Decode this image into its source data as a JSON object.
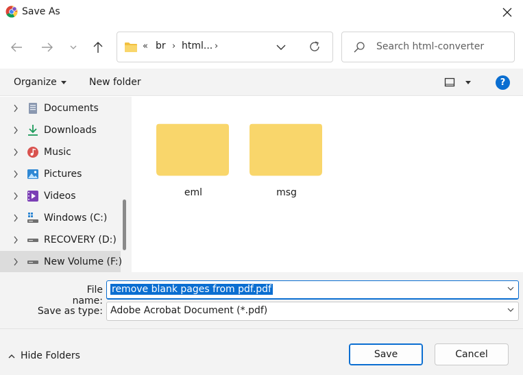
{
  "window": {
    "title": "Save As",
    "app_icon": "chrome-icon",
    "close_icon": "close-icon"
  },
  "nav": {
    "back_icon": "arrow-left-icon",
    "forward_icon": "arrow-right-icon",
    "recent_icon": "chevron-down-icon",
    "up_icon": "arrow-up-icon",
    "address": {
      "overflow": "«",
      "crumbs": [
        "br",
        "html..."
      ],
      "sep": "›"
    },
    "search_placeholder": "Search html-converter"
  },
  "commands": {
    "organize": "Organize",
    "new_folder": "New folder",
    "help": "?"
  },
  "sidebar": {
    "items": [
      {
        "label": "Documents",
        "icon": "documents-icon"
      },
      {
        "label": "Downloads",
        "icon": "downloads-icon"
      },
      {
        "label": "Music",
        "icon": "music-icon"
      },
      {
        "label": "Pictures",
        "icon": "pictures-icon"
      },
      {
        "label": "Videos",
        "icon": "videos-icon"
      },
      {
        "label": "Windows (C:)",
        "icon": "windows-drive-icon"
      },
      {
        "label": "RECOVERY (D:)",
        "icon": "drive-icon"
      },
      {
        "label": "New Volume (F:)",
        "icon": "drive-icon"
      }
    ],
    "selected_index": 7
  },
  "folders": [
    {
      "name": "eml"
    },
    {
      "name": "msg"
    }
  ],
  "form": {
    "file_name_label": "File name:",
    "file_name_value": "remove blank pages from pdf.pdf",
    "save_type_label": "Save as type:",
    "save_type_value": "Adobe Acrobat Document (*.pdf)"
  },
  "footer": {
    "hide_folders": "Hide Folders",
    "save": "Save",
    "cancel": "Cancel"
  },
  "colors": {
    "accent": "#0a6ed1",
    "folder": "#f9d66b",
    "folder_back": "#f2c040",
    "pane_bg": "#f3f3f3"
  }
}
